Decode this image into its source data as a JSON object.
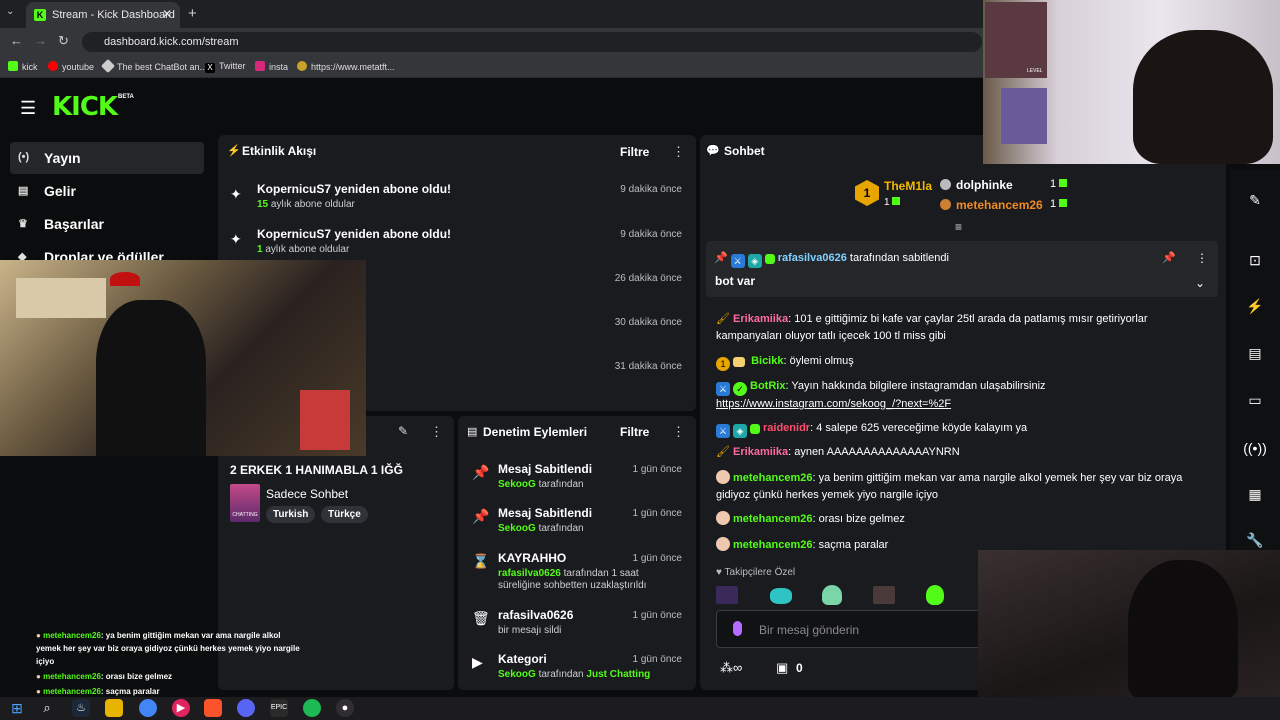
{
  "browser": {
    "tab_title": "Stream - Kick Dashboard",
    "tab_favicon": "K",
    "url": "dashboard.kick.com/stream",
    "bookmarks": [
      "kick",
      "youtube",
      "The best ChatBot an...",
      "Twitter",
      "insta",
      "https://www.metatft..."
    ]
  },
  "kick": {
    "logo": "KICK",
    "beta": "BETA",
    "sidebar": [
      {
        "label": "Yayın",
        "icon": "broadcast-icon"
      },
      {
        "label": "Gelir",
        "icon": "revenue-icon"
      },
      {
        "label": "Başarılar",
        "icon": "trophy-icon"
      },
      {
        "label": "Droplar ve ödüller",
        "icon": "gift-icon"
      }
    ]
  },
  "activity": {
    "title": "Etkinlik Akışı",
    "filter": "Filtre",
    "events": [
      {
        "title": "KopernicuS7 yeniden abone oldu!",
        "months": "15",
        "suffix": "aylık abone oldular",
        "time": "9 dakika önce"
      },
      {
        "title": "KopernicuS7 yeniden abone oldu!",
        "months": "1",
        "suffix": "aylık abone oldular",
        "time": "9 dakika önce"
      },
      {
        "time": "26 dakika önce"
      },
      {
        "time": "30 dakika önce"
      },
      {
        "time": "31 dakika önce"
      }
    ]
  },
  "stream_info": {
    "title": "2 ERKEK 1 HANIMABLA 1 IĞĞ",
    "category": "Sadece Sohbet",
    "tags": [
      "Turkish",
      "Türkçe"
    ]
  },
  "moderation": {
    "title": "Denetim Eylemleri",
    "filter": "Filtre",
    "items": [
      {
        "title": "Mesaj Sabitlendi",
        "user": "SekooG",
        "detail": "tarafından",
        "time": "1 gün önce",
        "icon": "pin-icon"
      },
      {
        "title": "Mesaj Sabitlendi",
        "user": "SekooG",
        "detail": "tarafından",
        "time": "1 gün önce",
        "icon": "pin-icon"
      },
      {
        "title": "KAYRAHHO",
        "user": "rafasilva0626",
        "detail": "tarafından 1 saat süreliğine sohbetten uzaklaştırıldı",
        "time": "1 gün önce",
        "icon": "hourglass-icon"
      },
      {
        "title": "rafasilva0626",
        "user": "",
        "detail": "bir mesajı sildi",
        "time": "1 gün önce",
        "icon": "trash-icon"
      },
      {
        "title": "Kategori",
        "user": "SekooG",
        "detail": "tarafından",
        "extra": "Just Chatting",
        "time": "1 gün önce",
        "icon": "category-icon"
      }
    ]
  },
  "chat": {
    "title": "Sohbet",
    "leaderboard": [
      {
        "rank": "1",
        "name": "TheM1la",
        "count": "1"
      },
      {
        "name": "dolphinke",
        "count": "1"
      },
      {
        "name": "metehancem26",
        "count": "1"
      }
    ],
    "pinned": {
      "by": "rafasilva0626",
      "suffix": "tarafından sabitlendi",
      "text": "bot var"
    },
    "messages": [
      {
        "user": "Erikamiika",
        "color": "#ff6b9d",
        "text": "101 e gittiğimiz bi kafe var çaylar 25tl arada da patlamış mısır getiriyorlar kampanyaları oluyor tatlı içecek 100 tl miss gibi"
      },
      {
        "user": "Bicikk",
        "color": "#53fc18",
        "text": "öylemi olmuş"
      },
      {
        "user": "BotRix",
        "color": "#53fc18",
        "text": "Yayın hakkında bilgilere instagramdan ulaşabilirsiniz",
        "link": "https://www.instagram.com/sekoog_/?next=%2F"
      },
      {
        "user": "raidenidr",
        "color": "#ff4d6d",
        "text": "4 salepe 625 vereceğime köyde kalayım ya"
      },
      {
        "user": "Erikamiika",
        "color": "#ff6b9d",
        "text": "aynen AAAAAAAAAAAAAAYNRN"
      },
      {
        "user": "metehancem26",
        "color": "#53fc18",
        "text": "ya benim gittiğim mekan var ama nargile alkol yemek her şey var biz oraya gidiyoz çünkü herkes yemek yiyo nargile içiyo"
      },
      {
        "user": "metehancem26",
        "color": "#53fc18",
        "text": "orası bize gelmez"
      },
      {
        "user": "metehancem26",
        "color": "#53fc18",
        "text": "saçma paralar"
      }
    ],
    "followers_only": "Takipçilere Özel",
    "input_placeholder": "Bir mesaj gönderin",
    "points": "0"
  },
  "overlay_chat": [
    {
      "user": "metehancem26",
      "text": ": ya benim gittiğim mekan var ama nargile alkol yemek her şey var biz oraya gidiyoz çünkü herkes yemek yiyo nargile içiyo"
    },
    {
      "user": "metehancem26",
      "text": ": orası bize gelmez"
    },
    {
      "user": "metehancem26",
      "text": ": saçma paralar"
    }
  ],
  "webcam_labels": {
    "level": "LEVEL"
  }
}
